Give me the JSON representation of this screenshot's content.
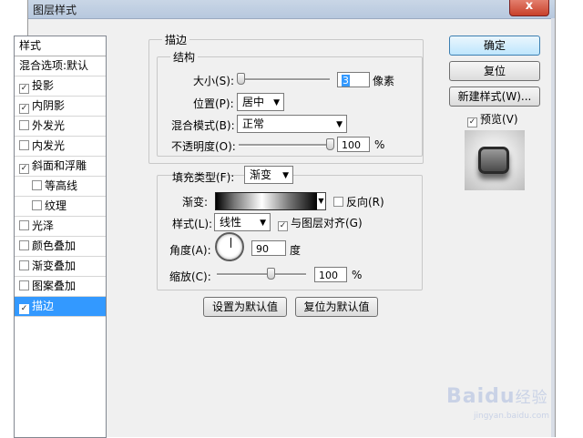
{
  "window": {
    "title": "图层样式",
    "close_label": "x"
  },
  "stylelist": {
    "header": "样式",
    "items": [
      {
        "label": "混合选项:默认",
        "checkbox": false,
        "checked": false,
        "sub": false,
        "selected": false
      },
      {
        "label": "投影",
        "checkbox": true,
        "checked": true,
        "sub": false,
        "selected": false
      },
      {
        "label": "内阴影",
        "checkbox": true,
        "checked": true,
        "sub": false,
        "selected": false
      },
      {
        "label": "外发光",
        "checkbox": true,
        "checked": false,
        "sub": false,
        "selected": false
      },
      {
        "label": "内发光",
        "checkbox": true,
        "checked": false,
        "sub": false,
        "selected": false
      },
      {
        "label": "斜面和浮雕",
        "checkbox": true,
        "checked": true,
        "sub": false,
        "selected": false
      },
      {
        "label": "等高线",
        "checkbox": true,
        "checked": false,
        "sub": true,
        "selected": false
      },
      {
        "label": "纹理",
        "checkbox": true,
        "checked": false,
        "sub": true,
        "selected": false
      },
      {
        "label": "光泽",
        "checkbox": true,
        "checked": false,
        "sub": false,
        "selected": false
      },
      {
        "label": "颜色叠加",
        "checkbox": true,
        "checked": false,
        "sub": false,
        "selected": false
      },
      {
        "label": "渐变叠加",
        "checkbox": true,
        "checked": false,
        "sub": false,
        "selected": false
      },
      {
        "label": "图案叠加",
        "checkbox": true,
        "checked": false,
        "sub": false,
        "selected": false
      },
      {
        "label": "描边",
        "checkbox": true,
        "checked": true,
        "sub": false,
        "selected": true
      }
    ]
  },
  "stroke": {
    "group_title": "描边",
    "structure_title": "结构",
    "size_label": "大小(S):",
    "size_value": "3",
    "size_unit": "像素",
    "size_level": 0.02,
    "position_label": "位置(P):",
    "position_value": "居中",
    "blend_label": "混合模式(B):",
    "blend_value": "正常",
    "opacity_label": "不透明度(O):",
    "opacity_value": "100",
    "opacity_unit": "%",
    "opacity_level": 1.0
  },
  "fill": {
    "type_label": "填充类型(F):",
    "type_value": "渐变",
    "gradient_label": "渐变:",
    "reverse_label": "反向(R)",
    "reverse_checked": false,
    "style_label": "样式(L):",
    "style_value": "线性",
    "align_label": "与图层对齐(G)",
    "align_checked": true,
    "angle_label": "角度(A):",
    "angle_value": "90",
    "angle_unit": "度",
    "scale_label": "缩放(C):",
    "scale_value": "100",
    "scale_unit": "%",
    "scale_level": 0.6
  },
  "defaults": {
    "make_default": "设置为默认值",
    "reset_default": "复位为默认值"
  },
  "actions": {
    "ok": "确定",
    "reset": "复位",
    "new_style": "新建样式(W)...",
    "preview_label": "预览(V)",
    "preview_checked": true
  },
  "watermark": {
    "brand": "Baidu",
    "suffix": "经验",
    "url": "jingyan.baidu.com"
  },
  "colors": {
    "selection": "#3399ff",
    "dialog_bg": "#f0f0f0"
  },
  "icons": {
    "check": "✓",
    "dropdown": "▼"
  }
}
